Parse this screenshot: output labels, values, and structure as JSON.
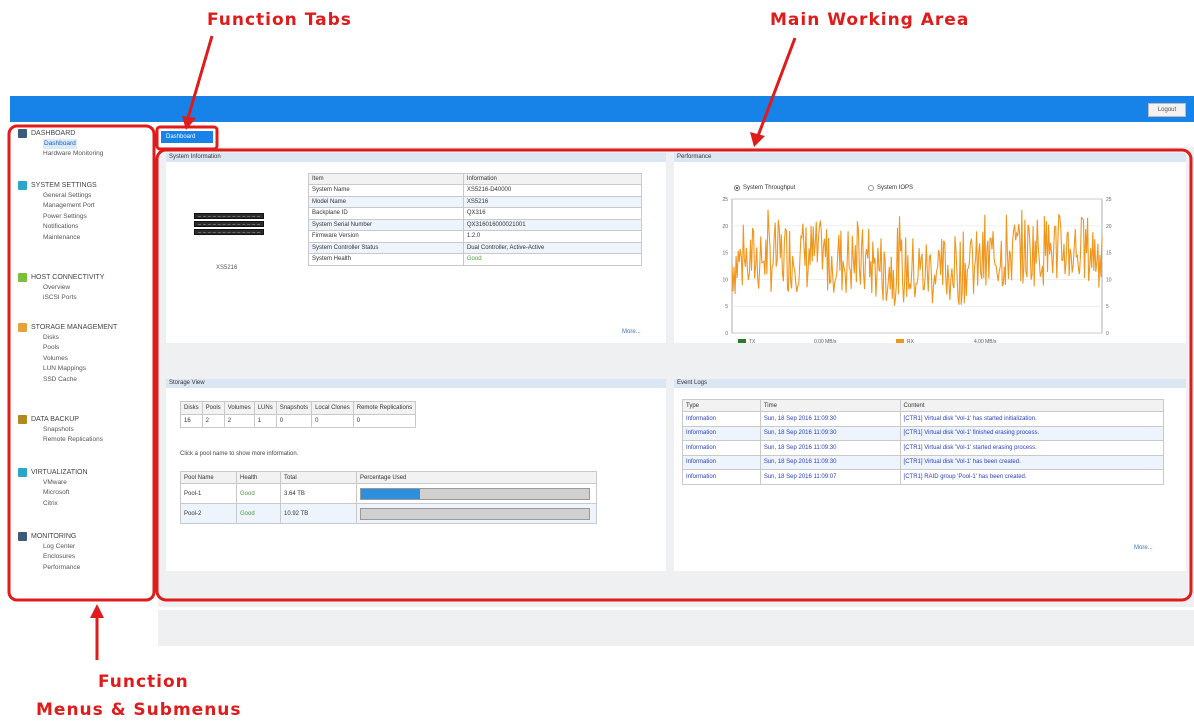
{
  "annotations": {
    "function_tabs": "Function Tabs",
    "main_working_area": "Main Working Area",
    "function_menus_line1": "Function",
    "function_menus_line2": "Menus & Submenus"
  },
  "header": {
    "logout_label": "Logout"
  },
  "sidebar": {
    "groups": [
      {
        "title": "DASHBOARD",
        "icon": "dashboard-icon",
        "color": "#3d5a7a",
        "items": [
          "Dashboard",
          "Hardware Monitoring"
        ]
      },
      {
        "title": "SYSTEM SETTINGS",
        "icon": "settings-icon",
        "color": "#2aa6c9",
        "items": [
          "General Settings",
          "Management Port",
          "Power Settings",
          "Notifications",
          "Maintenance"
        ]
      },
      {
        "title": "HOST CONNECTIVITY",
        "icon": "host-icon",
        "color": "#7bbf3a",
        "items": [
          "Overview",
          "iSCSI Ports"
        ]
      },
      {
        "title": "STORAGE MANAGEMENT",
        "icon": "storage-icon",
        "color": "#e8a23a",
        "items": [
          "Disks",
          "Pools",
          "Volumes",
          "LUN Mappings",
          "SSD Cache"
        ]
      },
      {
        "title": "DATA BACKUP",
        "icon": "backup-icon",
        "color": "#b08a1f",
        "items": [
          "Snapshots",
          "Remote Replications"
        ]
      },
      {
        "title": "VIRTUALIZATION",
        "icon": "virtualization-icon",
        "color": "#2aa6c9",
        "items": [
          "VMware",
          "Microsoft",
          "Citrix"
        ]
      },
      {
        "title": "MONITORING",
        "icon": "monitoring-icon",
        "color": "#3d5a7a",
        "items": [
          "Log Center",
          "Enclosures",
          "Performance"
        ]
      }
    ]
  },
  "tabs": {
    "dashboard": "Dashboard"
  },
  "system_info": {
    "title": "System Information",
    "model_caption": "XS5216",
    "headers": [
      "Item",
      "Information"
    ],
    "rows": [
      [
        "System Name",
        "XS5216-D40000"
      ],
      [
        "Model Name",
        "XS5216"
      ],
      [
        "Backplane ID",
        "QX316"
      ],
      [
        "System Serial Number",
        "QX316016000021001"
      ],
      [
        "Firmware Version",
        "1.2.0"
      ],
      [
        "System Controller Status",
        "Dual Controller, Active-Active"
      ],
      [
        "System Health",
        "Good"
      ]
    ],
    "more": "More..."
  },
  "performance": {
    "title": "Performance",
    "radio_throughput": "System Throughput",
    "radio_iops": "System IOPS",
    "y_ticks": [
      "25",
      "20",
      "15",
      "10",
      "5",
      "0"
    ],
    "legend_tx": "TX",
    "legend_tx_value": "0.00 MB/s",
    "legend_rx": "RX",
    "legend_rx_value": "4.00 MB/s",
    "tx_color": "#2a7a2a",
    "rx_color": "#f0961d"
  },
  "storage_view": {
    "title": "Storage View",
    "summary_headers": [
      "Disks",
      "Pools",
      "Volumes",
      "LUNs",
      "Snapshots",
      "Local Clones",
      "Remote Replications"
    ],
    "summary_values": [
      "16",
      "2",
      "2",
      "1",
      "0",
      "0",
      "0"
    ],
    "hint": "Click a pool name to show more information.",
    "pool_headers": [
      "Pool Name",
      "Health",
      "Total",
      "Percentage Used"
    ],
    "pools": [
      {
        "name": "Pool-1",
        "health": "Good",
        "total": "3.64 TB",
        "used_pct": 26
      },
      {
        "name": "Pool-2",
        "health": "Good",
        "total": "10.92 TB",
        "used_pct": 0
      }
    ]
  },
  "event_logs": {
    "title": "Event Logs",
    "headers": [
      "Type",
      "Time",
      "Content"
    ],
    "rows": [
      [
        "Information",
        "Sun, 18 Sep 2016 11:09:30",
        "[CTR1] Virtual disk 'Vol-1' has started initialization."
      ],
      [
        "Information",
        "Sun, 18 Sep 2016 11:09:30",
        "[CTR1] Virtual disk 'Vol-1' finished erasing process."
      ],
      [
        "Information",
        "Sun, 18 Sep 2016 11:09:30",
        "[CTR1] Virtual disk 'Vol-1' started erasing process."
      ],
      [
        "Information",
        "Sun, 18 Sep 2016 11:09:30",
        "[CTR1] Virtual disk 'Vol-1' has been created."
      ],
      [
        "Information",
        "Sun, 18 Sep 2016 11:09:07",
        "[CTR1] RAID group 'Pool-1' has been created."
      ]
    ],
    "more": "More..."
  }
}
